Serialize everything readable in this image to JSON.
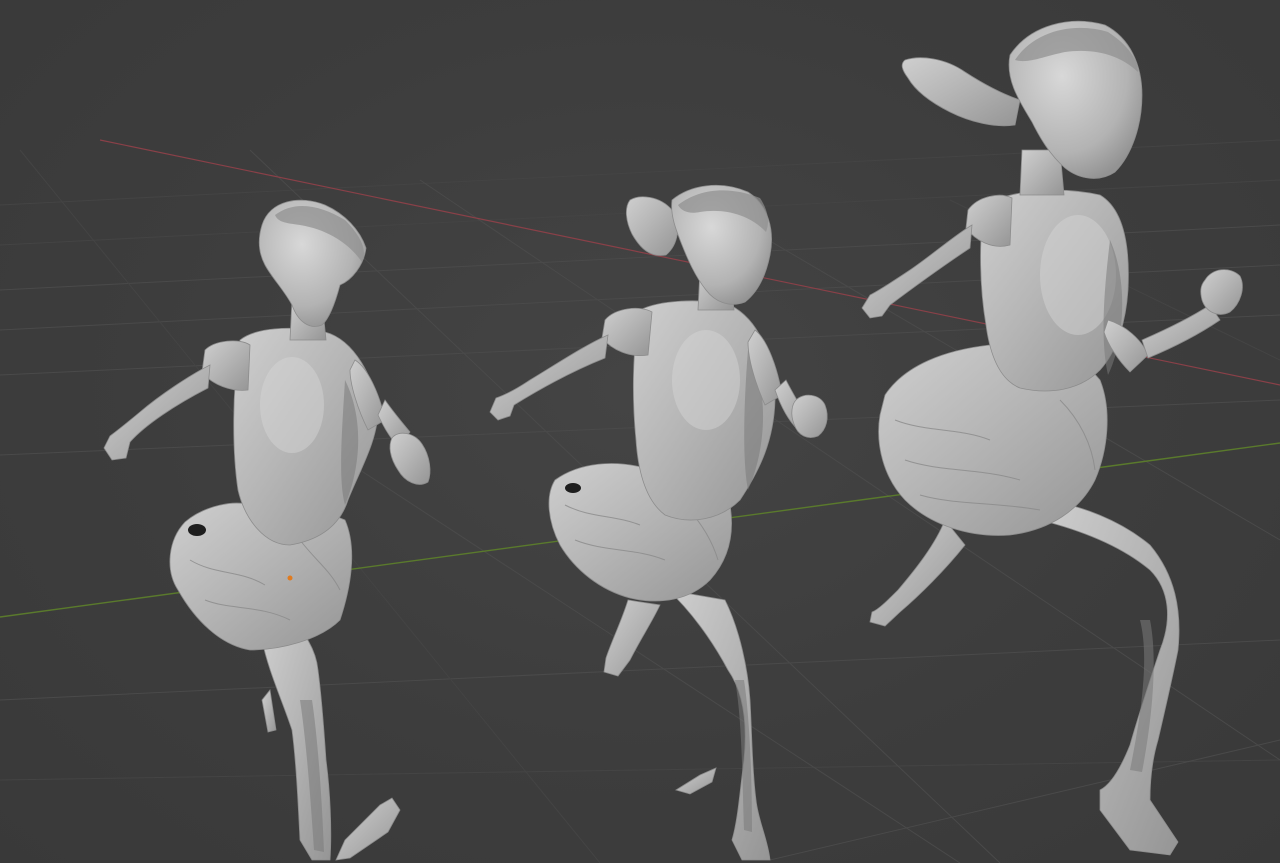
{
  "viewport": {
    "background": "#3d3d3d",
    "grid_color": "#4a4a4a",
    "x_axis_color": "#8a4048",
    "y_axis_color": "#5a7a2c",
    "material_color": "#b4b4b4",
    "origin_marker_color": "#e07b1f"
  },
  "scene": {
    "objects": [
      {
        "name": "sculpt-figure-left",
        "kind": "running-girl-sculpt"
      },
      {
        "name": "sculpt-figure-center",
        "kind": "running-girl-sculpt"
      },
      {
        "name": "sculpt-figure-right",
        "kind": "running-girl-sculpt"
      }
    ]
  }
}
